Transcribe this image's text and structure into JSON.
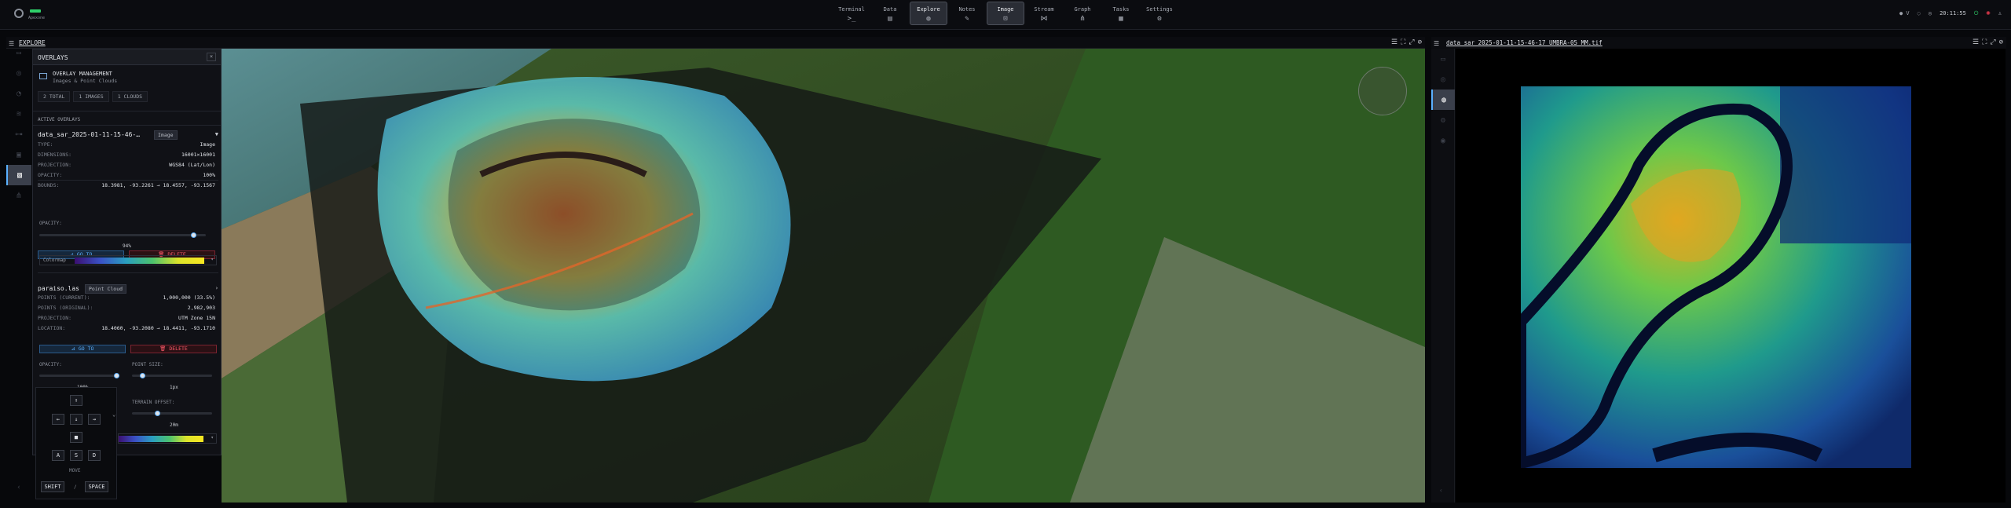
{
  "brand": {
    "name": "Apexone"
  },
  "nav": [
    {
      "label": "Terminal",
      "icon": ">_"
    },
    {
      "label": "Data",
      "icon": "▤"
    },
    {
      "label": "Explore",
      "icon": "◍"
    },
    {
      "label": "Notes",
      "icon": "✎"
    },
    {
      "label": "Image",
      "icon": "⊡"
    },
    {
      "label": "Stream",
      "icon": "⋈"
    },
    {
      "label": "Graph",
      "icon": "⋔"
    },
    {
      "label": "Tasks",
      "icon": "▦"
    },
    {
      "label": "Settings",
      "icon": "⚙"
    }
  ],
  "nav_active": "Explore",
  "topright": {
    "mic": "● V",
    "time": "20:11:55"
  },
  "explore": {
    "title": "EXPLORE"
  },
  "overlays": {
    "title": "OVERLAYS",
    "close": "×",
    "management": {
      "title": "OVERLAY MANAGEMENT",
      "subtitle": "Images & Point Clouds"
    },
    "counts": {
      "total": "2 TOTAL",
      "images": "1 IMAGES",
      "clouds": "1 CLOUDS"
    },
    "active_label": "ACTIVE OVERLAYS",
    "image": {
      "name": "data_sar_2025-01-11-15-46-…",
      "badge": "Image",
      "rows": [
        {
          "k": "TYPE:",
          "v": "Image"
        },
        {
          "k": "DIMENSIONS:",
          "v": "16001×16001"
        },
        {
          "k": "PROJECTION:",
          "v": "WGS84 (Lat/Lon)"
        },
        {
          "k": "OPACITY:",
          "v": "100%"
        },
        {
          "k": "BOUNDS:",
          "v": "18.3981, -93.2261 → 18.4557, -93.1567"
        }
      ],
      "goto": "⊿ GO TO",
      "delete": "🗑 DELETE",
      "opacity_label": "OPACITY:",
      "opacity_value": "94%",
      "opacity_fraction": 0.94,
      "colormap_label": "Colormap"
    },
    "cloud": {
      "name": "paraiso.las",
      "badge": "Point Cloud",
      "rows": [
        {
          "k": "POINTS (CURRENT):",
          "v": "1,000,000 (33.5%)"
        },
        {
          "k": "POINTS (ORIGINAL):",
          "v": "2,982,903"
        },
        {
          "k": "PROJECTION:",
          "v": "UTM Zone 15N"
        },
        {
          "k": "LOCATION:",
          "v": "18.4060, -93.2080 → 18.4411, -93.1710"
        }
      ],
      "goto": "⊿ GO TO",
      "delete": "🗑 DELETE",
      "opacity_label": "OPACITY:",
      "opacity_value": "100%",
      "opacity_fraction": 1.0,
      "pointsize_label": "POINT SIZE:",
      "pointsize_value": "1px",
      "pointsize_fraction": 0.1,
      "terrain_label": "TERRAIN OFFSET:",
      "terrain_value": "20m",
      "terrain_fraction": 0.3
    }
  },
  "keyboard": {
    "up": "↑",
    "left": "←",
    "down": "↓",
    "right": "→",
    "stop": "■",
    "a": "A",
    "s": "S",
    "d": "D",
    "move": "MOVE",
    "shift": "SHIFT",
    "slash": "/",
    "space": "SPACE",
    "chevron": "⌄"
  },
  "right_panel": {
    "title": "data_sar_2025-01-11-15-46-17_UMBRA-05_MM.tif"
  },
  "icons": {
    "hamburger": "menu-icon",
    "compass": "compass-icon"
  },
  "colors": {
    "accent": "#5ab0ff",
    "danger": "#ff5a6a",
    "ok": "#2fd06a"
  }
}
